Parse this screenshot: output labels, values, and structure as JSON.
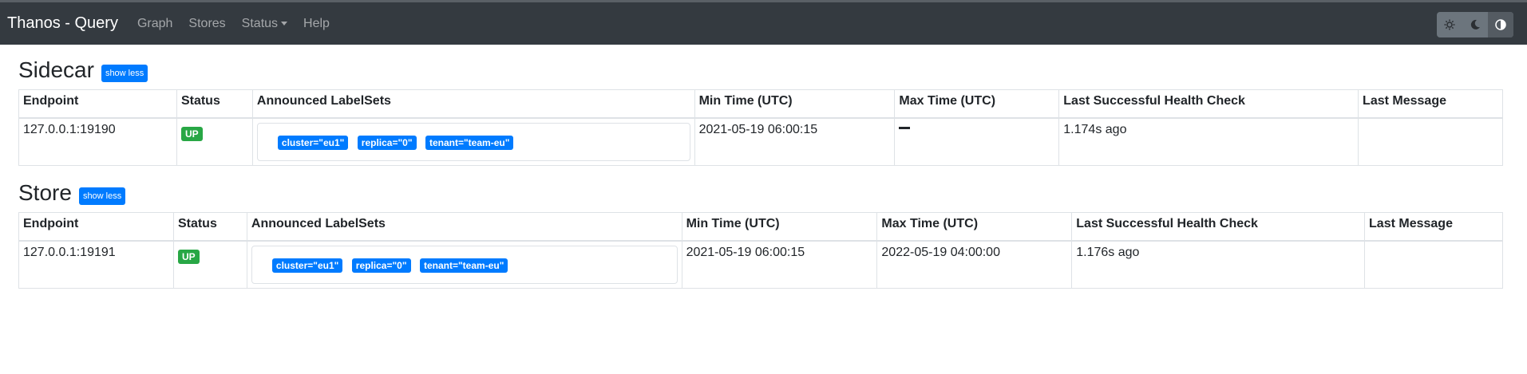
{
  "navbar": {
    "brand": "Thanos - Query",
    "links": [
      "Graph",
      "Stores",
      "Status",
      "Help"
    ],
    "theme_icons": [
      "sun-icon",
      "moon-icon",
      "contrast-icon"
    ]
  },
  "sections": [
    {
      "title": "Sidecar",
      "toggle_label": "show less",
      "headers": [
        "Endpoint",
        "Status",
        "Announced LabelSets",
        "Min Time (UTC)",
        "Max Time (UTC)",
        "Last Successful Health Check",
        "Last Message"
      ],
      "rows": [
        {
          "endpoint": "127.0.0.1:19190",
          "status": "UP",
          "labels": [
            "cluster=\"eu1\"",
            "replica=\"0\"",
            "tenant=\"team-eu\""
          ],
          "min_time": "2021-05-19 06:00:15",
          "max_time": "",
          "last_check": "1.174s ago",
          "last_message": ""
        }
      ]
    },
    {
      "title": "Store",
      "toggle_label": "show less",
      "headers": [
        "Endpoint",
        "Status",
        "Announced LabelSets",
        "Min Time (UTC)",
        "Max Time (UTC)",
        "Last Successful Health Check",
        "Last Message"
      ],
      "rows": [
        {
          "endpoint": "127.0.0.1:19191",
          "status": "UP",
          "labels": [
            "cluster=\"eu1\"",
            "replica=\"0\"",
            "tenant=\"team-eu\""
          ],
          "min_time": "2021-05-19 06:00:15",
          "max_time": "2022-05-19 04:00:00",
          "last_check": "1.176s ago",
          "last_message": ""
        }
      ]
    }
  ],
  "colors": {
    "navbar": "#343a40",
    "primary": "#007bff",
    "success": "#28a745"
  }
}
